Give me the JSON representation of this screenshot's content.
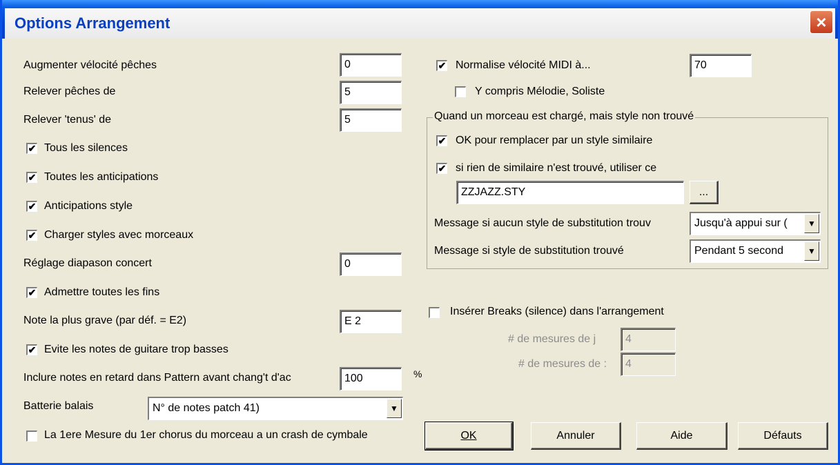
{
  "window": {
    "title": "Options Arrangement",
    "close_icon": "×"
  },
  "left": {
    "aug_velocite": {
      "label": "Augmenter vélocité pêches",
      "value": "0"
    },
    "relever_peches": {
      "label": "Relever pêches de",
      "value": "5"
    },
    "relever_tenus": {
      "label": "Relever 'tenus' de",
      "value": "5"
    },
    "tous_silences": {
      "label": "Tous les silences",
      "checked": "✔"
    },
    "toutes_anticipations": {
      "label": "Toutes les anticipations",
      "checked": "✔"
    },
    "anticipations_style": {
      "label": "Anticipations style",
      "checked": "✔"
    },
    "charger_styles": {
      "label": "Charger styles avec morceaux",
      "checked": "✔"
    },
    "diapason": {
      "label": "Réglage diapason concert",
      "value": "0"
    },
    "admettre_fins": {
      "label": "Admettre toutes les fins",
      "checked": "✔"
    },
    "note_grave": {
      "label": "Note la plus grave (par déf. = E2)",
      "value": "E 2"
    },
    "evite_notes": {
      "label": "Evite les notes de guitare trop basses",
      "checked": "✔"
    },
    "inclure_notes": {
      "label": "Inclure notes en retard dans Pattern avant chang't d'ac",
      "value": "100",
      "unit": "%"
    },
    "batterie": {
      "label": "Batterie balais",
      "value": "N° de notes patch 41)"
    },
    "crash_cymbale": {
      "label": "La 1ere Mesure du 1er chorus du morceau a un crash de cymbale",
      "checked": ""
    }
  },
  "right": {
    "normalise": {
      "label": "Normalise vélocité MIDI à...",
      "checked": "✔",
      "value": "70"
    },
    "y_compris": {
      "label": "Y compris Mélodie, Soliste",
      "checked": ""
    },
    "group": {
      "title": "Quand un morceau est chargé, mais style non trouvé",
      "ok_remplacer": {
        "label": "OK pour remplacer par un style similaire",
        "checked": "✔"
      },
      "si_rien": {
        "label": "si rien de similaire n'est trouvé, utiliser ce",
        "checked": "✔"
      },
      "style_file": "ZZJAZZ.STY",
      "browse": "...",
      "msg_aucun": {
        "label": "Message si aucun style de substitution trouv",
        "value": "Jusqu'à appui sur ("
      },
      "msg_trouve": {
        "label": "Message si style de substitution trouvé",
        "value": "Pendant 5 second"
      }
    },
    "inserer_breaks": {
      "label": "Insérer Breaks (silence) dans l'arrangement",
      "checked": ""
    },
    "mesures_1": {
      "label": "# de mesures de j",
      "value": "4"
    },
    "mesures_2": {
      "label": "# de mesures de :",
      "value": "4"
    }
  },
  "buttons": {
    "ok": "OK",
    "annuler": "Annuler",
    "aide": "Aide",
    "defauts": "Défauts"
  },
  "dropdown_arrow": "▼"
}
